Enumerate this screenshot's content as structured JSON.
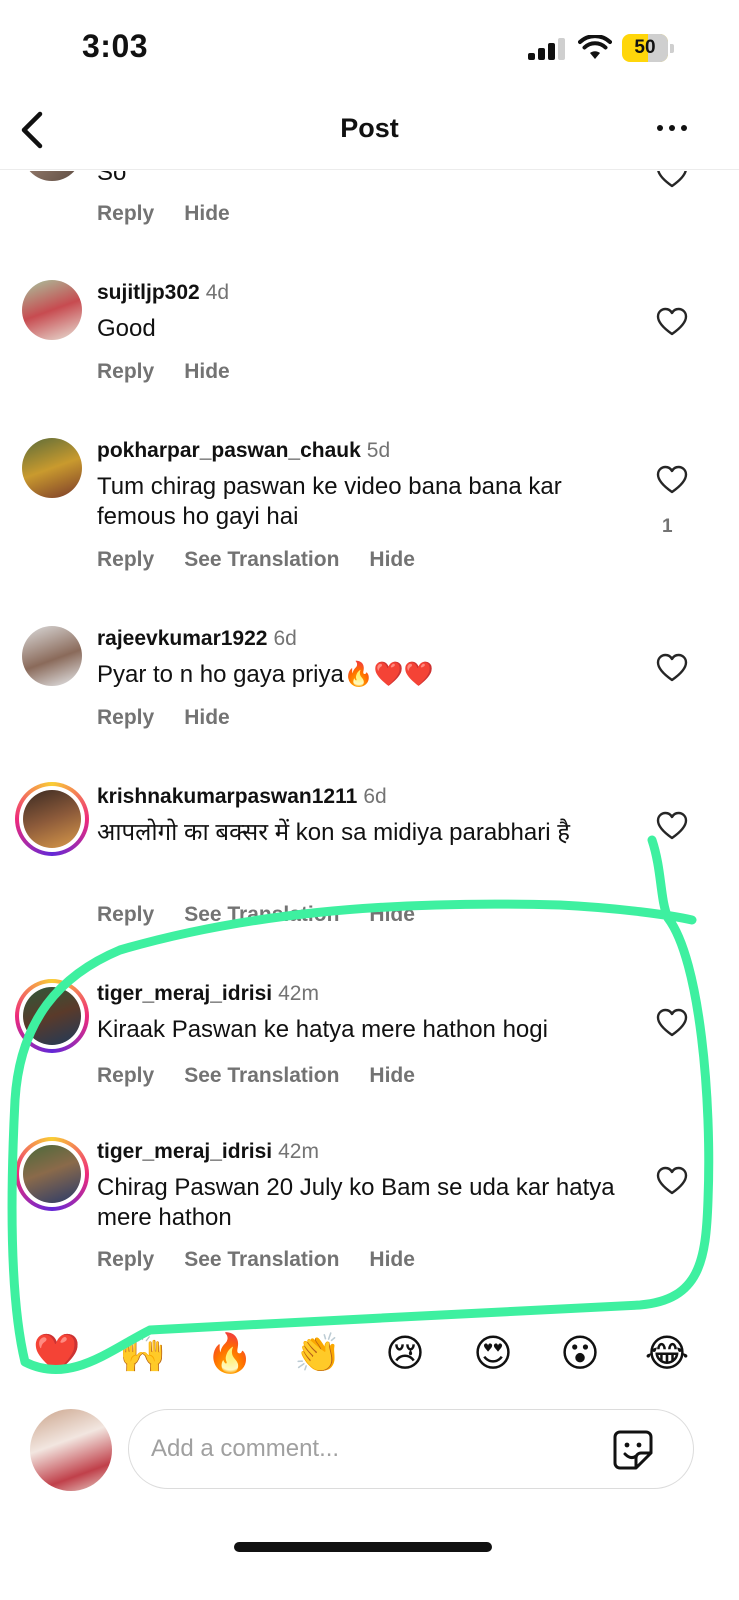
{
  "status_bar": {
    "time": "3:03",
    "battery": "50"
  },
  "header": {
    "title": "Post"
  },
  "partial_comment": {
    "text": "So",
    "actions": {
      "reply": "Reply",
      "hide": "Hide"
    }
  },
  "comments": [
    {
      "username": "sujitljp302",
      "time": "4d",
      "text": "Good",
      "actions": {
        "reply": "Reply",
        "hide": "Hide"
      }
    },
    {
      "username": "pokharpar_paswan_chauk",
      "time": "5d",
      "text": "Tum chirag paswan ke video bana bana kar femous ho gayi hai",
      "likes": "1",
      "actions": {
        "reply": "Reply",
        "translate": "See Translation",
        "hide": "Hide"
      }
    },
    {
      "username": "rajeevkumar1922",
      "time": "6d",
      "text": "Pyar to n ho gaya priya🔥❤️❤️",
      "actions": {
        "reply": "Reply",
        "hide": "Hide"
      }
    },
    {
      "username": "krishnakumarpaswan1211",
      "time": "6d",
      "text": "आपलोगो का बक्सर में kon sa midiya parabhari है",
      "actions": {
        "reply": "Reply",
        "translate": "See Translation",
        "hide": "Hide"
      }
    },
    {
      "username": "tiger_meraj_idrisi",
      "time": "42m",
      "text": "Kiraak Paswan ke hatya mere hathon hogi",
      "actions": {
        "reply": "Reply",
        "translate": "See Translation",
        "hide": "Hide"
      }
    },
    {
      "username": "tiger_meraj_idrisi",
      "time": "42m",
      "text": "Chirag Paswan 20 July ko Bam se uda kar hatya mere hathon",
      "actions": {
        "reply": "Reply",
        "translate": "See Translation",
        "hide": "Hide"
      }
    }
  ],
  "emoji_bar": [
    "❤️",
    "🙌",
    "🔥",
    "👏",
    "😢",
    "😍",
    "😮",
    "😂"
  ],
  "comment_input": {
    "placeholder": "Add a comment..."
  },
  "colors": {
    "annotation": "#3ef0a0",
    "secondary_text": "#737373",
    "highlight_ring": "#ee2a7b"
  },
  "icons": [
    "back-chevron-icon",
    "more-options-icon",
    "heart-icon",
    "sticker-icon",
    "signal-icon",
    "wifi-icon",
    "battery-icon"
  ]
}
